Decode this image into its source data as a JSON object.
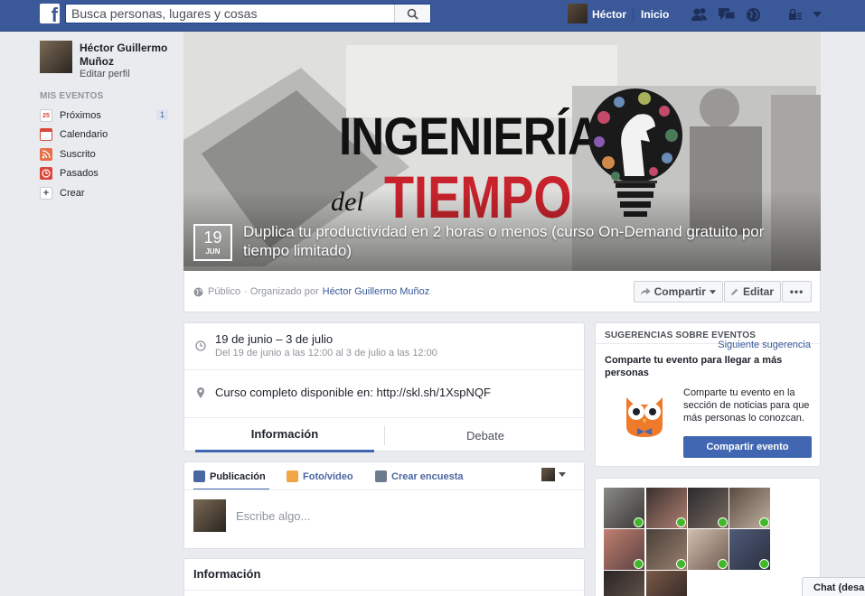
{
  "topbar": {
    "logo": "f",
    "search_placeholder": "Busca personas, lugares y cosas",
    "user_name": "Héctor",
    "home_label": "Inicio",
    "icons": [
      "friend-requests-icon",
      "messages-icon",
      "notifications-globe-icon",
      "privacy-lock-icon",
      "account-menu-caret-icon"
    ]
  },
  "sidebar": {
    "name": "Héctor Guillermo Muñoz",
    "edit_profile": "Editar perfil",
    "section_title": "MIS EVENTOS",
    "items": [
      {
        "label": "Próximos",
        "icon": "calendar-25-icon",
        "badge_text": "25",
        "count": "1"
      },
      {
        "label": "Calendario",
        "icon": "calendar-icon"
      },
      {
        "label": "Suscrito",
        "icon": "rss-icon"
      },
      {
        "label": "Pasados",
        "icon": "clock-icon"
      },
      {
        "label": "Crear",
        "icon": "plus-icon"
      }
    ]
  },
  "cover": {
    "image_logo_line1": "INGENIERÍA",
    "image_logo_line2": "del",
    "image_logo_line3": "TIEMPO",
    "date_day": "19",
    "date_month": "JUN",
    "title": "Duplica tu productividad en 2 horas o menos (curso On-Demand gratuito por tiempo limitado)"
  },
  "event_meta": {
    "privacy": "Público",
    "organized_by_prefix": "· Organizado por",
    "organizer": "Héctor Guillermo Muñoz",
    "share_label": "Compartir",
    "edit_label": "Editar",
    "more_label": "•••"
  },
  "details": {
    "date_main": "19 de junio – 3 de julio",
    "date_sub": "Del 19 de junio a las 12:00 al 3 de julio a las 12:00",
    "location": "Curso completo disponible en: http://skl.sh/1XspNQF",
    "tabs": [
      {
        "label": "Información",
        "active": true
      },
      {
        "label": "Debate",
        "active": false
      }
    ]
  },
  "composer": {
    "tabs": [
      "Publicación",
      "Foto/video",
      "Crear encuesta"
    ],
    "placeholder": "Escribe algo..."
  },
  "info_section": {
    "title": "Información"
  },
  "suggestions": {
    "header": "SUGERENCIAS SOBRE EVENTOS",
    "next": "Siguiente sugerencia",
    "title": "Comparte tu evento para llegar a más personas",
    "text": "Comparte tu evento en la sección de noticias para que más personas lo conozcan.",
    "button": "Compartir evento"
  },
  "guests": {
    "thumb_count": 11
  },
  "chat": {
    "label": "Chat (desa"
  },
  "colors": {
    "brand_blue": "#3b5998",
    "link_blue": "#365899",
    "button_blue": "#4267b2",
    "background": "#e9ebee",
    "check_green": "#42b72a"
  }
}
